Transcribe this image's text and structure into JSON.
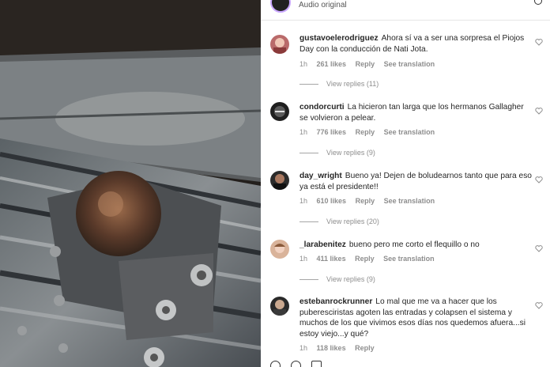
{
  "post": {
    "audio_label": "Audio original",
    "view_replies_prefix": "View replies"
  },
  "comments": [
    {
      "username": "gustavoelerodriguez",
      "text": "Ahora sí va a ser una sorpresa el Piojos Day con la conducción de Nati Jota.",
      "time": "1h",
      "likes": "261 likes",
      "reply": "Reply",
      "translation": "See translation",
      "view_replies": "View replies (11)"
    },
    {
      "username": "condorcurti",
      "text": "La hicieron tan larga que los hermanos Gallagher se volvieron a pelear.",
      "time": "1h",
      "likes": "776 likes",
      "reply": "Reply",
      "translation": "See translation",
      "view_replies": "View replies (9)"
    },
    {
      "username": "day_wright",
      "text": "Bueno ya! Dejen de boludearnos tanto que para eso ya está el presidente!!",
      "time": "1h",
      "likes": "610 likes",
      "reply": "Reply",
      "translation": "See translation",
      "view_replies": "View replies (20)"
    },
    {
      "username": "_larabenitez",
      "text": "bueno pero me corto el flequillo o no",
      "time": "1h",
      "likes": "411 likes",
      "reply": "Reply",
      "translation": "See translation",
      "view_replies": "View replies (9)"
    },
    {
      "username": "estebanrockrunner",
      "text": "Lo mal que me va a hacer que los puberesciristas agoten las entradas y colapsen el sistema y muchos de los que vivimos esos días nos quedemos afuera...si estoy viejo...y qué?",
      "time": "1h",
      "likes": "118 likes",
      "reply": "Reply",
      "translation": "",
      "view_replies": ""
    }
  ],
  "colors": {
    "text": "#262626",
    "meta": "#8e8e8e",
    "panel_bg": "#ffffff"
  }
}
